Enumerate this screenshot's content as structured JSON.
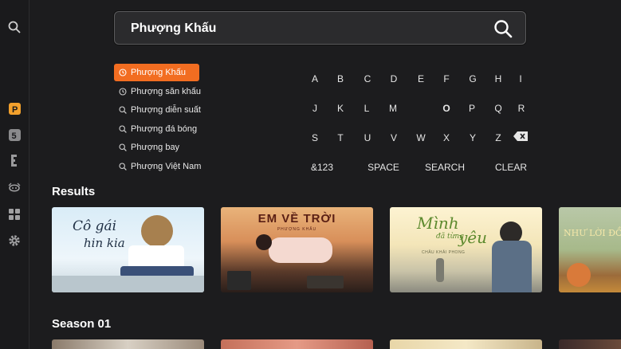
{
  "search": {
    "query": "Phượng Khấu"
  },
  "suggestions": [
    {
      "label": "Phượng Khấu",
      "kind": "history",
      "active": true
    },
    {
      "label": "Phượng săn khấu",
      "kind": "history",
      "active": false
    },
    {
      "label": "Phượng diễn suất",
      "kind": "search",
      "active": false
    },
    {
      "label": "Phượng đá bóng",
      "kind": "search",
      "active": false
    },
    {
      "label": "Phượng bay",
      "kind": "search",
      "active": false
    },
    {
      "label": "Phượng Việt Nam",
      "kind": "search",
      "active": false
    }
  ],
  "keyboard": {
    "rows": [
      [
        "A",
        "B",
        "C",
        "D",
        "E",
        "F",
        "G",
        "H",
        "I"
      ],
      [
        "J",
        "K",
        "L",
        "M",
        "O",
        "P",
        "Q",
        "R"
      ],
      [
        "S",
        "T",
        "U",
        "V",
        "W",
        "X",
        "Y",
        "Z"
      ]
    ],
    "actions": [
      "&123",
      "SPACE",
      "SEARCH",
      "CLEAR"
    ]
  },
  "sections": {
    "results": "Results",
    "season": "Season 01"
  },
  "cards": {
    "card1": {
      "title": "Cô gái",
      "title2": "hin kia"
    },
    "card2": {
      "title": "EM VỀ TRỜI",
      "subtitle": "PHƯỢNG KHẤU"
    },
    "card3": {
      "title": "Mình",
      "title2": "yêu",
      "mid": "đã từng",
      "sub": "CHÂU KHẢI PHONG"
    },
    "card4": {
      "title": "NHƯ LỜI ĐỒN"
    },
    "season_card2": {
      "title": ""
    }
  }
}
